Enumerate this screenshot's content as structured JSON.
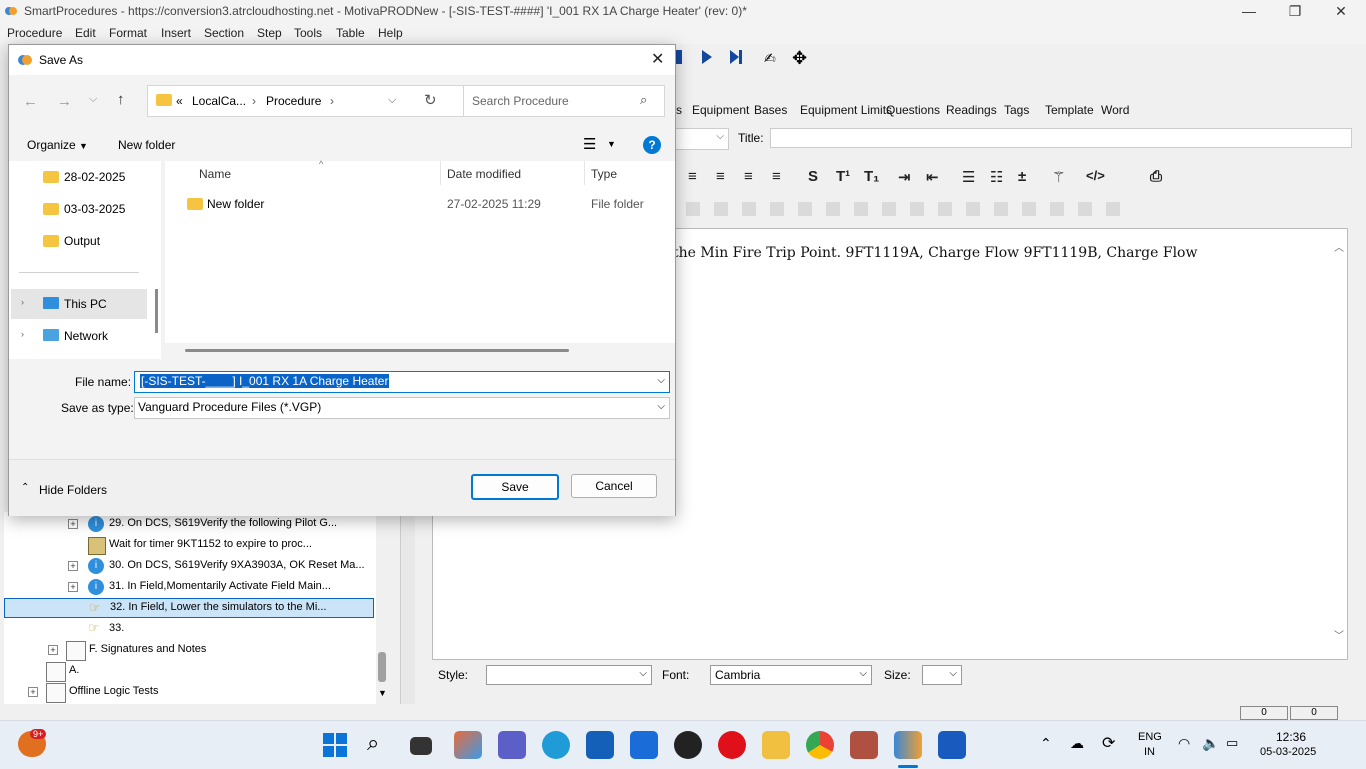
{
  "app": {
    "title": "SmartProcedures - https://conversion3.atrcloudhosting.net - MotivaPRODNew - [-SIS-TEST-####] 'I_001 RX 1A Charge Heater' (rev: 0)*",
    "menu": [
      "Procedure",
      "Edit",
      "Format",
      "Insert",
      "Section",
      "Step",
      "Tools",
      "Table",
      "Help"
    ],
    "tabs": [
      "s",
      "Equipment",
      "Bases",
      "Equipment Limits",
      "Questions",
      "Readings",
      "Tags",
      "Template",
      "Word"
    ],
    "title_label": "Title:",
    "editor_text": "the Min Fire Trip Point. 9FT1119A, Charge Flow 9FT1119B, Charge Flow",
    "style_label": "Style:",
    "font_label": "Font:",
    "font_value": "Cambria",
    "size_label": "Size:",
    "status_values": [
      "0",
      "0"
    ]
  },
  "tree": {
    "rows": [
      {
        "text": "29. On DCS, S619Verify the following Pilot G...",
        "icon": "info-icon"
      },
      {
        "text": "Wait for timer 9KT1152 to expire to proc...",
        "icon": "timer-icon"
      },
      {
        "text": "30. On DCS, S619Verify 9XA3903A, OK Reset Ma...",
        "icon": "info-icon"
      },
      {
        "text": "31. In Field,Momentarily Activate Field Main...",
        "icon": "info-icon"
      },
      {
        "text": "32. In Field, Lower the simulators to the Mi...",
        "icon": "hand-icon"
      },
      {
        "text": "33.",
        "icon": "hand-icon"
      },
      {
        "text": "F. Signatures and Notes",
        "icon": "document-icon"
      },
      {
        "text": "A.",
        "icon": "document-icon"
      },
      {
        "text": "Offline Logic Tests",
        "icon": "document-icon"
      }
    ]
  },
  "dialog": {
    "title": "Save As",
    "breadcrumb": [
      "«",
      "LocalCa...",
      "Procedure"
    ],
    "search_placeholder": "Search Procedure",
    "organize": "Organize",
    "new_folder": "New folder",
    "nav_items": [
      "28-02-2025",
      "03-03-2025",
      "Output",
      "This PC",
      "Network"
    ],
    "columns": [
      "Name",
      "Date modified",
      "Type"
    ],
    "files": [
      {
        "name": "New folder",
        "date": "27-02-2025 11:29",
        "type": "File folder"
      }
    ],
    "file_name_label": "File name:",
    "file_name_value": "[-SIS-TEST-____] I_001 RX 1A Charge Heater",
    "save_type_label": "Save as type:",
    "save_type_value": "Vanguard Procedure Files (*.VGP)",
    "hide_folders": "Hide Folders",
    "save_button": "Save",
    "cancel_button": "Cancel"
  },
  "taskbar": {
    "badge": "9+",
    "lang_line1": "ENG",
    "lang_line2": "IN",
    "time": "12:36",
    "date": "05-03-2025"
  },
  "colors": {
    "accent": "#0078d4",
    "selection": "#0a64c8",
    "tree_selected": "#cce4f7"
  }
}
